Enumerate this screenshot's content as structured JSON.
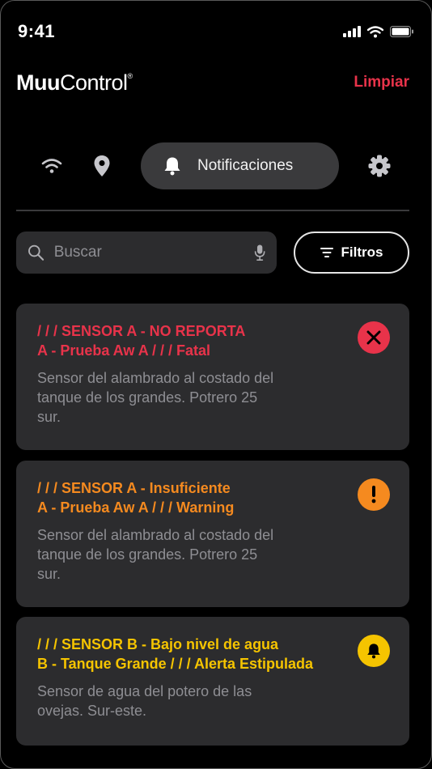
{
  "status_bar": {
    "time": "9:41"
  },
  "header": {
    "logo_bold": "Muu",
    "logo_light": "Control",
    "logo_reg": "®",
    "clear_label": "Limpiar"
  },
  "tabs": {
    "active_label": "Notificaciones"
  },
  "search": {
    "placeholder": "Buscar"
  },
  "filter": {
    "label": "Filtros"
  },
  "notifications": [
    {
      "title_line1": "/ / /  SENSOR A - NO REPORTA",
      "title_line2": "A - Prueba Aw A  / / / Fatal",
      "description": "Sensor del alambrado al costado del tanque de los grandes. Potrero 25 sur.",
      "color": "#e8334a",
      "icon": "close-icon"
    },
    {
      "title_line1": "/ / /  SENSOR A - Insuficiente",
      "title_line2": "A - Prueba Aw A  / / / Warning",
      "description": "Sensor del alambrado al costado del tanque de los grandes. Potrero 25 sur.",
      "color": "#f58a1f",
      "icon": "exclamation-icon"
    },
    {
      "title_line1": "/ / /  SENSOR B - Bajo nivel de agua",
      "title_line2": "B - Tanque Grande / / / Alerta Estipulada",
      "description": "Sensor de agua del potero de las ovejas. Sur-este.",
      "color": "#f5c400",
      "icon": "bell-icon"
    }
  ]
}
